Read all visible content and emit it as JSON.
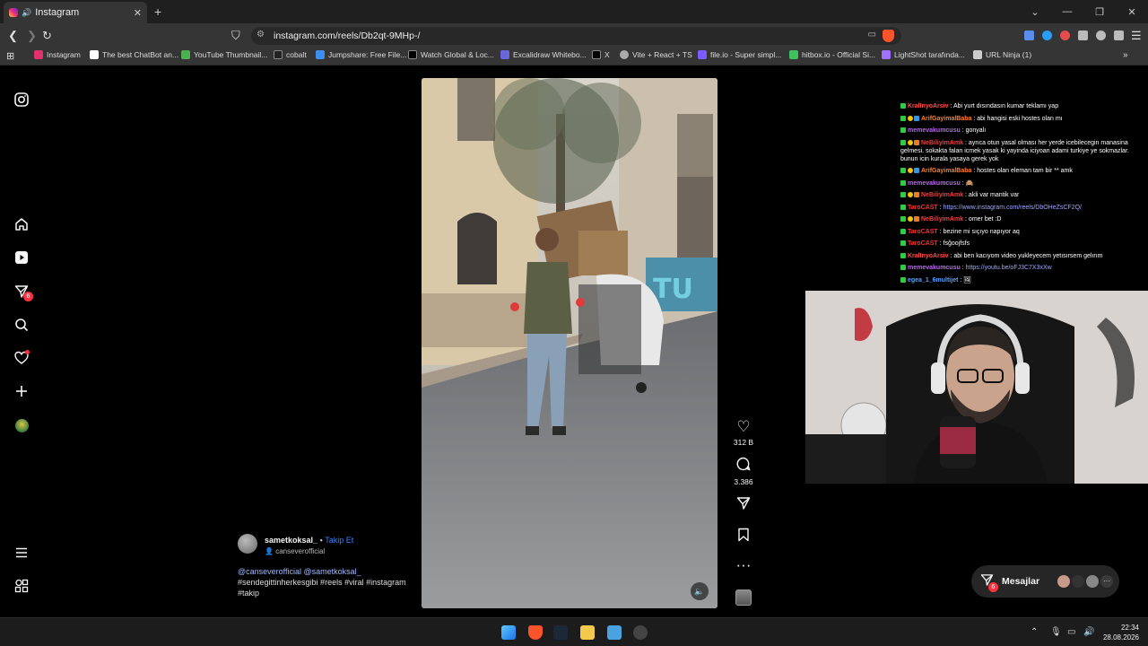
{
  "browser": {
    "tab_title": "Instagram",
    "new_tab_glyph": "+",
    "url": "instagram.com/reels/Db2qt-9MHp-/",
    "bookmarks": [
      {
        "label": "Instagram",
        "color": "#e1306c"
      },
      {
        "label": "The best ChatBot an...",
        "color": "#ffffff"
      },
      {
        "label": "YouTube Thumbnail...",
        "color": "#4caf50"
      },
      {
        "label": "cobalt",
        "color": "#222222"
      },
      {
        "label": "Jumpshare: Free File...",
        "color": "#3d8ef0"
      },
      {
        "label": "Watch Global & Loc...",
        "color": "#000000"
      },
      {
        "label": "Excalidraw Whitebo...",
        "color": "#6965db"
      },
      {
        "label": "X",
        "color": "#000000"
      },
      {
        "label": "Vite + React + TS",
        "color": "#aaaaaa"
      },
      {
        "label": "file.io - Super simpl...",
        "color": "#7b5cff"
      },
      {
        "label": "hitbox.io - Official Si...",
        "color": "#3fbf5f"
      },
      {
        "label": "LightShot tarafında...",
        "color": "#a070ff"
      },
      {
        "label": "URL Ninja (1)",
        "color": "#cccccc"
      }
    ]
  },
  "reel": {
    "username": "sametkoksal_",
    "follow_label": "Takip Et",
    "audio": "canseverofficial",
    "caption_mentions": "@canseverofficial @sametkoksal_",
    "caption_tags": "#sendegittinherkesgibi #reels #viral #instagram #takip",
    "likes": "312 B",
    "comments": "3.386"
  },
  "sidebar": {
    "notifications_badge": "6"
  },
  "chat": [
    {
      "user": "KralInyoArsiv",
      "color": "#ff4d4d",
      "text": "Abi yurt dısındasın kumar teklamı yap",
      "badges": 1
    },
    {
      "user": "ArifGayimalBaba",
      "color": "#ff7f27",
      "text": "abi hangisi eski hostes olan mı",
      "badges": 3
    },
    {
      "user": "memevakumcusu",
      "color": "#c061ff",
      "text": "gonyalı",
      "badges": 1
    },
    {
      "user": "NeBiliyimAmk",
      "color": "#ff3b3b",
      "text": "ayrıca otun yasal olması her yerde icebilecegin manasina gelmesi. sokakta falan icmek yasak ki yayinda iciyoan adami turkiye ye sokmazlar. bunun icin kurala yasaya gerek yok",
      "badges": 3
    },
    {
      "user": "ArifGayimalBaba",
      "color": "#ff7f27",
      "text": "hostes olan eleman tam bir ** amk",
      "badges": 3
    },
    {
      "user": "memevakumcusu",
      "color": "#c061ff",
      "text": "🙈",
      "badges": 1
    },
    {
      "user": "NeBiliyimAmk",
      "color": "#ff3b3b",
      "text": "akli var mantik var",
      "badges": 3
    },
    {
      "user": "TaroCAST",
      "color": "#ff2e2e",
      "text": "https://www.instagram.com/reels/DbOHeZsCF2Q/",
      "link": true,
      "badges": 1
    },
    {
      "user": "NeBiliyimAmk",
      "color": "#ff3b3b",
      "text": "omer bet :D",
      "badges": 3
    },
    {
      "user": "TaroCAST",
      "color": "#ff2e2e",
      "text": "bezine mi sıçıyo napıyor aq",
      "badges": 1
    },
    {
      "user": "TaroCAST",
      "color": "#ff2e2e",
      "text": "fsğoojfsfs",
      "badges": 1
    },
    {
      "user": "KralInyoArsiv",
      "color": "#ff4d4d",
      "text": "abi ben kacıyom video yukleyecem yetısırsem gelırım",
      "badges": 1
    },
    {
      "user": "memevakumcusu",
      "color": "#c061ff",
      "text": "https://youtu.be/oFJ3C7X3xXw",
      "link": true,
      "badges": 1
    },
    {
      "user": "egea_1_6multijet",
      "color": "#5aa0ff",
      "text": "🖼",
      "badges": 1
    }
  ],
  "messages": {
    "label": "Mesajlar",
    "badge": "6"
  },
  "taskbar": {
    "time": "22:34",
    "date": "28.08.2026"
  }
}
